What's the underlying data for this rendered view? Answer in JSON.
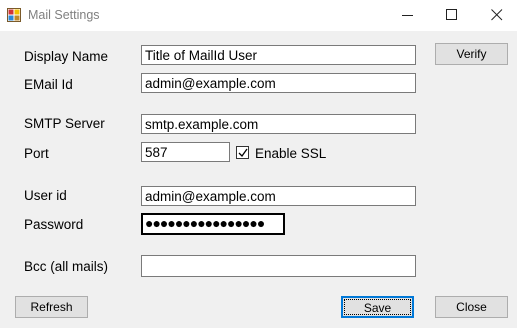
{
  "window": {
    "title": "Mail Settings"
  },
  "form": {
    "display_name": {
      "label": "Display Name",
      "value": "Title of MailId User"
    },
    "email_id": {
      "label": "EMail Id",
      "value": "admin@example.com"
    },
    "smtp_server": {
      "label": "SMTP Server",
      "value": "smtp.example.com"
    },
    "port": {
      "label": "Port",
      "value": "587"
    },
    "enable_ssl": {
      "label": "Enable SSL",
      "checked": true
    },
    "user_id": {
      "label": "User id",
      "value": "admin@example.com"
    },
    "password": {
      "label": "Password",
      "value": "●●●●●●●●●●●●●●●●"
    },
    "bcc": {
      "label": "Bcc (all mails)",
      "value": ""
    }
  },
  "buttons": {
    "verify": "Verify",
    "refresh": "Refresh",
    "save": "Save",
    "close": "Close"
  },
  "colors": {
    "accent": "#0078d7",
    "background": "#f0f0f0"
  },
  "icons": {
    "app": "mail-settings-app-icon",
    "minimize": "minimize-icon",
    "maximize": "maximize-icon",
    "close": "close-icon",
    "checkbox": "checkmark-icon"
  }
}
